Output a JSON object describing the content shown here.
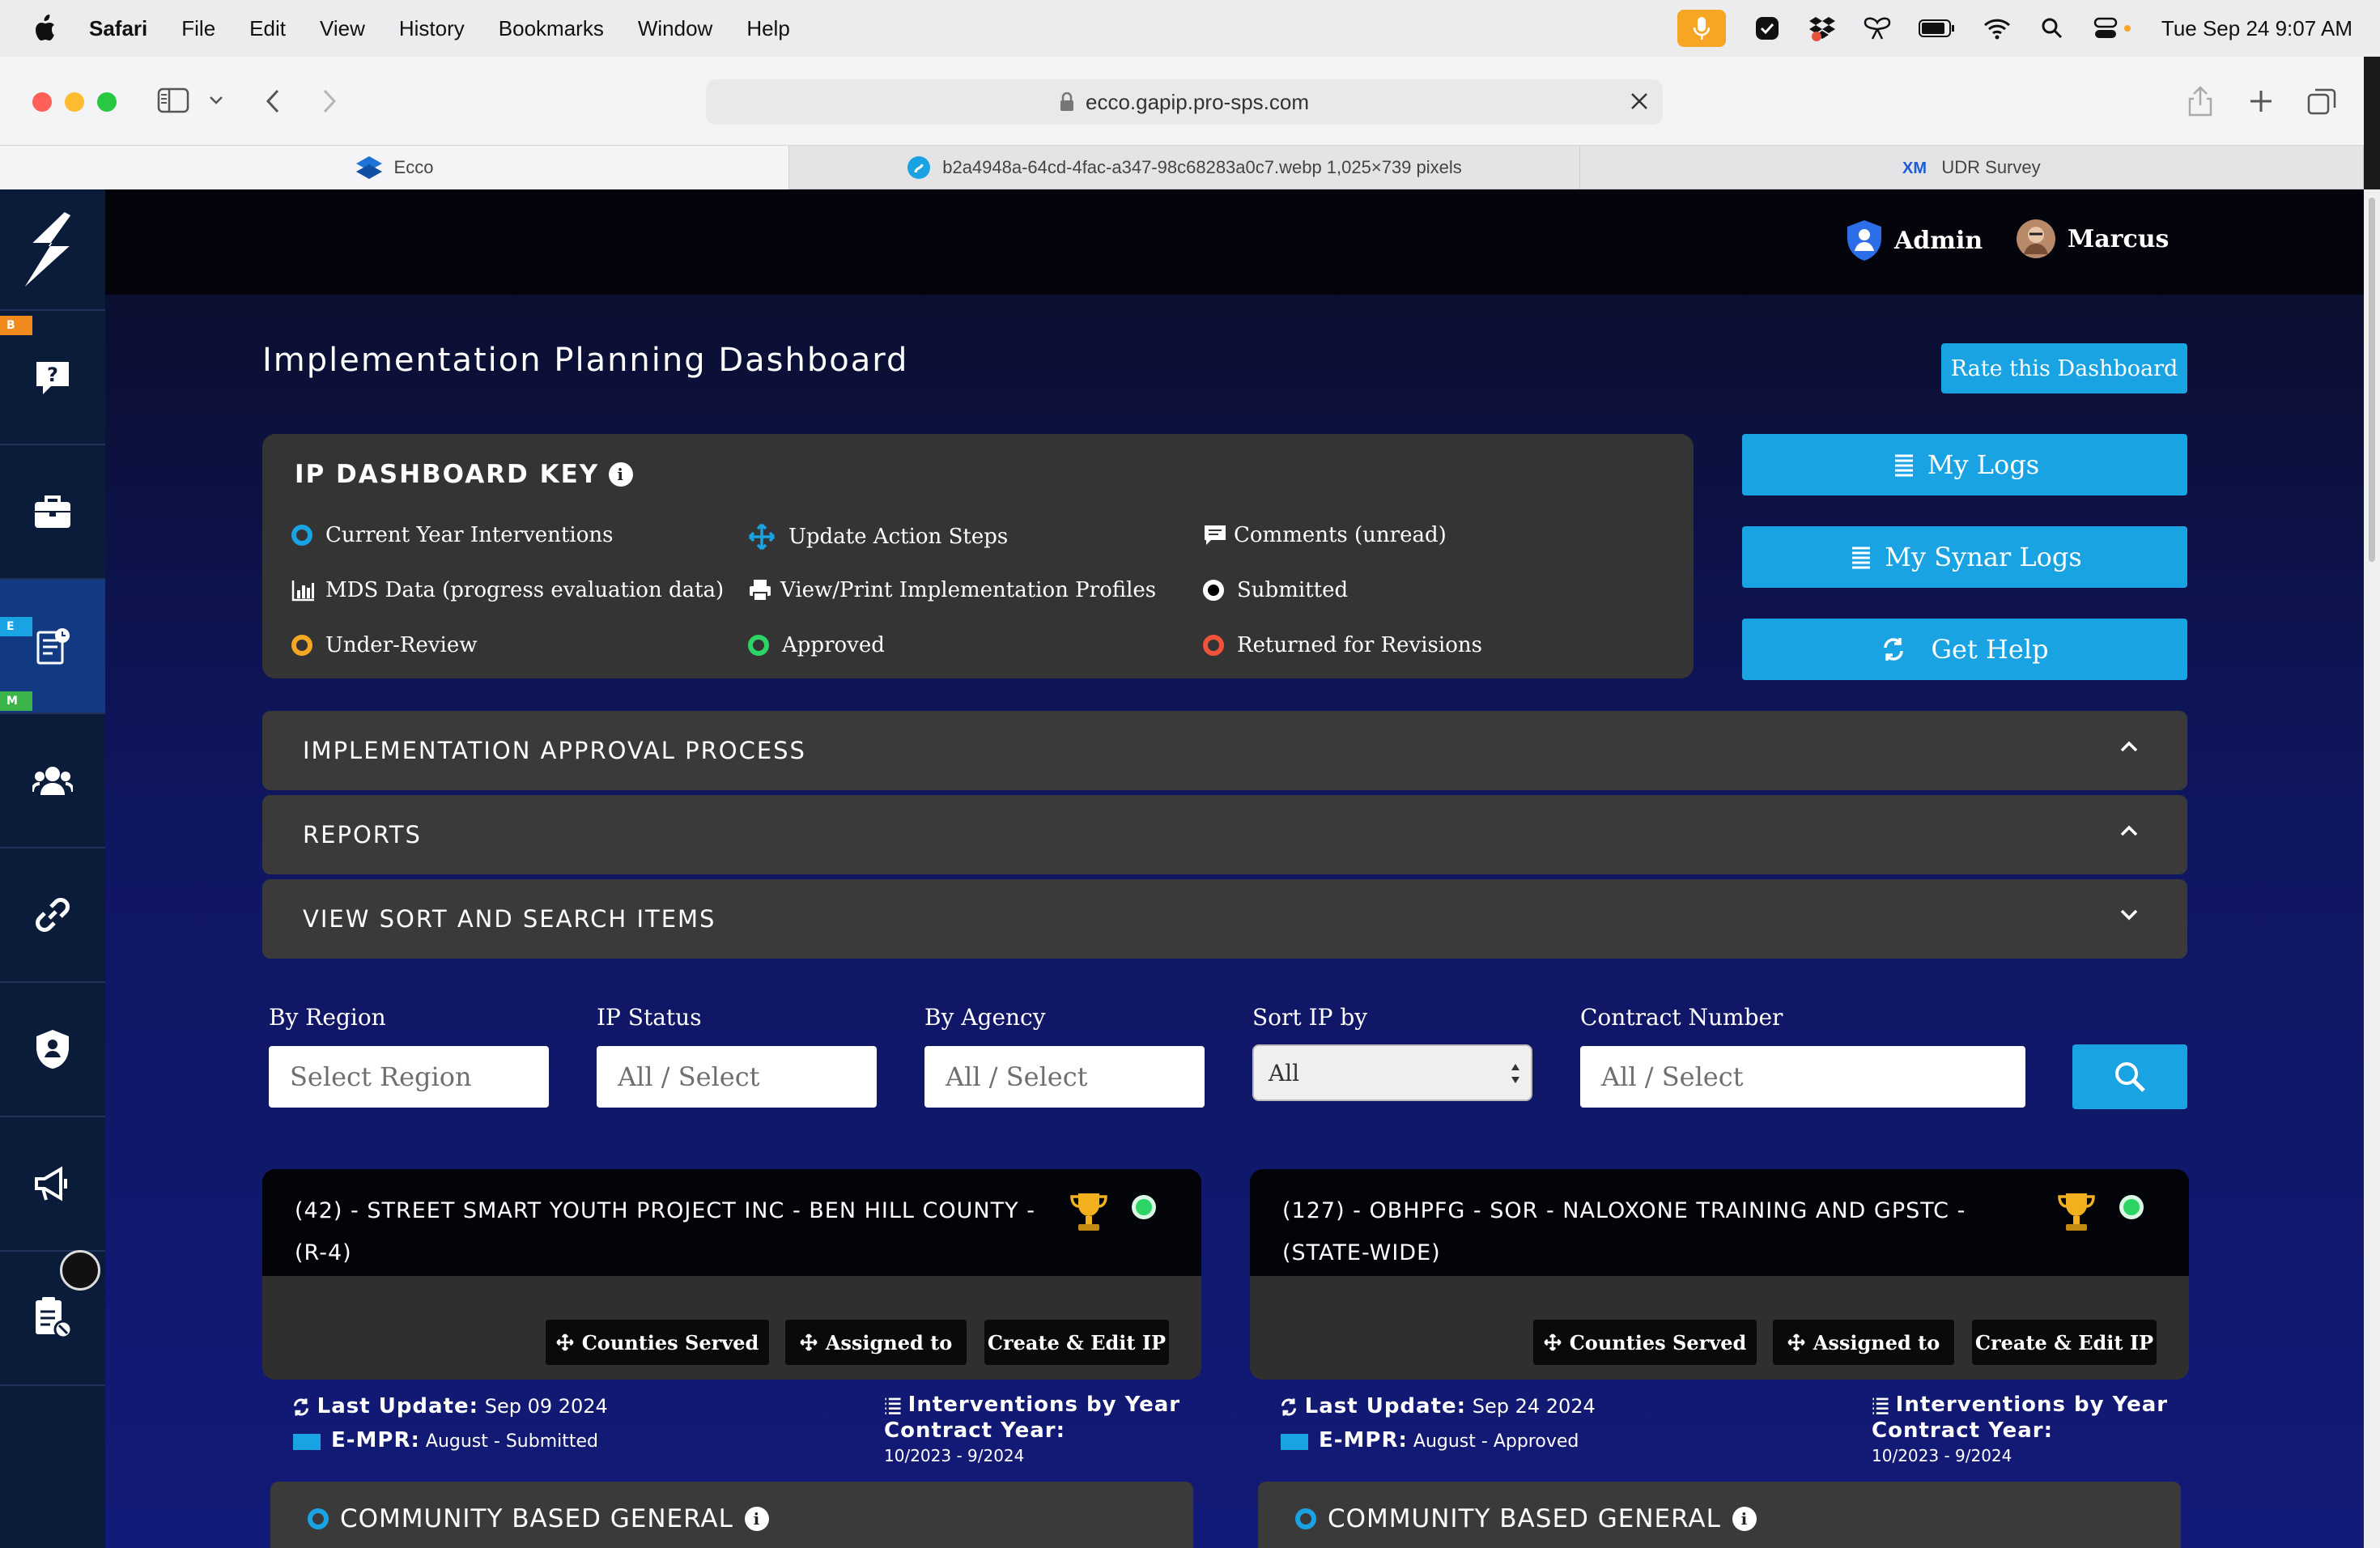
{
  "menubar": {
    "app": "Safari",
    "items": [
      "File",
      "Edit",
      "View",
      "History",
      "Bookmarks",
      "Window",
      "Help"
    ],
    "clock": "Tue Sep 24  9:07 AM"
  },
  "browser": {
    "url": "ecco.gapip.pro-sps.com",
    "tabs": [
      {
        "label": "Ecco"
      },
      {
        "label": "b2a4948a-64cd-4fac-a347-98c68283a0c7.webp 1,025×739 pixels"
      },
      {
        "label": "UDR Survey"
      }
    ]
  },
  "header": {
    "role": "Admin",
    "user": "Marcus"
  },
  "sidebar": {
    "flags": [
      "B",
      "E",
      "M"
    ]
  },
  "dashboard": {
    "title": "Implementation Planning Dashboard",
    "rate_button": "Rate this Dashboard"
  },
  "key": {
    "title": "IP DASHBOARD KEY",
    "items": [
      "Current Year Interventions",
      "Update Action Steps",
      "Comments (unread)",
      "MDS Data (progress evaluation data)",
      "View/Print Implementation Profiles",
      "Submitted",
      "Under-Review",
      "Approved",
      "Returned for Revisions"
    ]
  },
  "side_buttons": {
    "logs": "My Logs",
    "synar": "My Synar Logs",
    "help": "Get Help"
  },
  "accordions": [
    "IMPLEMENTATION APPROVAL PROCESS",
    "REPORTS",
    "VIEW SORT AND SEARCH ITEMS"
  ],
  "filters": {
    "region_label": "By Region",
    "region_placeholder": "Select Region",
    "status_label": "IP Status",
    "status_placeholder": "All / Select",
    "agency_label": "By Agency",
    "agency_placeholder": "All / Select",
    "sort_label": "Sort IP by",
    "sort_value": "All",
    "contract_label": "Contract Number",
    "contract_placeholder": "All / Select"
  },
  "cards": [
    {
      "title": "(42) - STREET SMART YOUTH PROJECT INC - BEN HILL COUNTY - (R-4)",
      "btn_counties": "Counties Served",
      "btn_assigned": "Assigned to",
      "btn_create": "Create & Edit IP",
      "last_update_label": "Last Update:",
      "last_update": "Sep 09 2024",
      "empr_label": "E-MPR:",
      "empr": "August - Submitted",
      "interventions_label": "Interventions by Year",
      "contract_year_label": "Contract Year:",
      "contract_year": "10/2023 - 9/2024",
      "category": "COMMUNITY BASED GENERAL"
    },
    {
      "title": "(127) - OBHPFG - SOR - NALOXONE TRAINING AND GPSTC - (STATE-WIDE)",
      "btn_counties": "Counties Served",
      "btn_assigned": "Assigned to",
      "btn_create": "Create & Edit IP",
      "last_update_label": "Last Update:",
      "last_update": "Sep 24 2024",
      "empr_label": "E-MPR:",
      "empr": "August - Approved",
      "interventions_label": "Interventions by Year",
      "contract_year_label": "Contract Year:",
      "contract_year": "10/2023 - 9/2024",
      "category": "COMMUNITY BASED GENERAL"
    }
  ],
  "colors": {
    "accent": "#1aa3e3",
    "submitted": "#000000",
    "under_review": "#f5a623",
    "approved": "#2bd465",
    "returned": "#f0523a",
    "current_year": "#1aa3e3"
  }
}
